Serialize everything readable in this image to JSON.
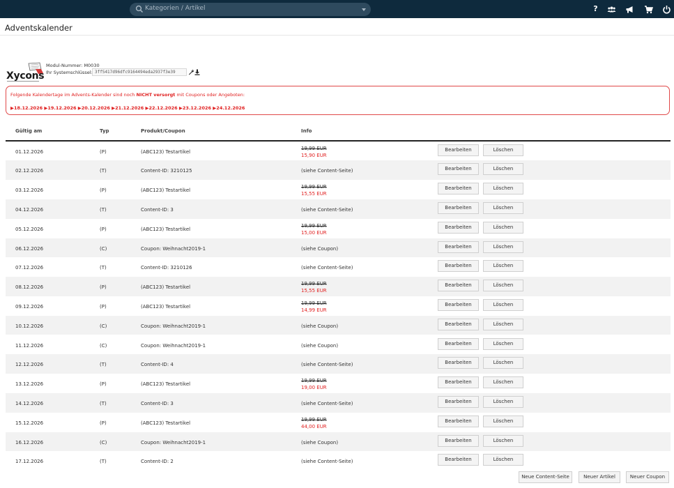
{
  "topbar": {
    "search_placeholder": "Kategorien / Artikel",
    "icons": [
      "help-icon",
      "users-icon",
      "megaphone-icon",
      "cart-icon",
      "power-icon"
    ],
    "help_glyph": "?"
  },
  "page": {
    "title": "Adventskalender"
  },
  "module": {
    "logo_text": "Xycons",
    "number_label": "Modul-Nummer: M0030",
    "syskey_label": "Ihr Systemschlüssel:",
    "syskey_value": "3ff5417d96dfc9164494eda2937f3e39"
  },
  "alert": {
    "msg_pre": "Folgende Kalendertage im Advents-Kalender sind noch ",
    "msg_bold": "NICHT versorgt",
    "msg_post": " mit Coupons oder Angeboten:",
    "dates": "▶18.12.2026 ▶19.12.2026 ▶20.12.2026 ▶21.12.2026 ▶22.12.2026 ▶23.12.2026 ▶24.12.2026",
    "color": "#e02020"
  },
  "table": {
    "headers": {
      "date": "Gültig am",
      "type": "Typ",
      "product": "Produkt/Coupon",
      "info": "Info"
    },
    "edit_label": "Bearbeiten",
    "delete_label": "Löschen",
    "rows": [
      {
        "date": "01.12.2026",
        "type": "(P)",
        "product": "(ABC123) Testartikel",
        "old": "19,99 EUR",
        "new": "15,90 EUR",
        "info": ""
      },
      {
        "date": "02.12.2026",
        "type": "(T)",
        "product": "Content-ID: 3210125",
        "old": "",
        "new": "",
        "info": "(siehe Content-Seite)"
      },
      {
        "date": "03.12.2026",
        "type": "(P)",
        "product": "(ABC123) Testartikel",
        "old": "19,99 EUR",
        "new": "15,55 EUR",
        "info": ""
      },
      {
        "date": "04.12.2026",
        "type": "(T)",
        "product": "Content-ID: 3",
        "old": "",
        "new": "",
        "info": "(siehe Content-Seite)"
      },
      {
        "date": "05.12.2026",
        "type": "(P)",
        "product": "(ABC123) Testartikel",
        "old": "19,99 EUR",
        "new": "15,00 EUR",
        "info": ""
      },
      {
        "date": "06.12.2026",
        "type": "(C)",
        "product": "Coupon: Weihnacht2019-1",
        "old": "",
        "new": "",
        "info": "(siehe Coupon)"
      },
      {
        "date": "07.12.2026",
        "type": "(T)",
        "product": "Content-ID: 3210126",
        "old": "",
        "new": "",
        "info": "(siehe Content-Seite)"
      },
      {
        "date": "08.12.2026",
        "type": "(P)",
        "product": "(ABC123) Testartikel",
        "old": "19,99 EUR",
        "new": "15,55 EUR",
        "info": ""
      },
      {
        "date": "09.12.2026",
        "type": "(P)",
        "product": "(ABC123) Testartikel",
        "old": "19,99 EUR",
        "new": "14,99 EUR",
        "info": ""
      },
      {
        "date": "10.12.2026",
        "type": "(C)",
        "product": "Coupon: Weihnacht2019-1",
        "old": "",
        "new": "",
        "info": "(siehe Coupon)"
      },
      {
        "date": "11.12.2026",
        "type": "(C)",
        "product": "Coupon: Weihnacht2019-1",
        "old": "",
        "new": "",
        "info": "(siehe Coupon)"
      },
      {
        "date": "12.12.2026",
        "type": "(T)",
        "product": "Content-ID: 4",
        "old": "",
        "new": "",
        "info": "(siehe Content-Seite)"
      },
      {
        "date": "13.12.2026",
        "type": "(P)",
        "product": "(ABC123) Testartikel",
        "old": "19,99 EUR",
        "new": "19,00 EUR",
        "info": ""
      },
      {
        "date": "14.12.2026",
        "type": "(T)",
        "product": "Content-ID: 3",
        "old": "",
        "new": "",
        "info": "(siehe Content-Seite)"
      },
      {
        "date": "15.12.2026",
        "type": "(P)",
        "product": "(ABC123) Testartikel",
        "old": "19,99 EUR",
        "new": "44,00 EUR",
        "info": ""
      },
      {
        "date": "16.12.2026",
        "type": "(C)",
        "product": "Coupon: Weihnacht2019-1",
        "old": "",
        "new": "",
        "info": "(siehe Coupon)"
      },
      {
        "date": "17.12.2026",
        "type": "(T)",
        "product": "Content-ID: 2",
        "old": "",
        "new": "",
        "info": "(siehe Content-Seite)"
      }
    ]
  },
  "footer": {
    "new_content": "Neue Content-Seite",
    "new_article": "Neuer Artikel",
    "new_coupon": "Neuer Coupon"
  },
  "colors": {
    "topbar": "#0e2a3d",
    "accent_red": "#e02020",
    "row_stripe": "#f2f2f2"
  }
}
